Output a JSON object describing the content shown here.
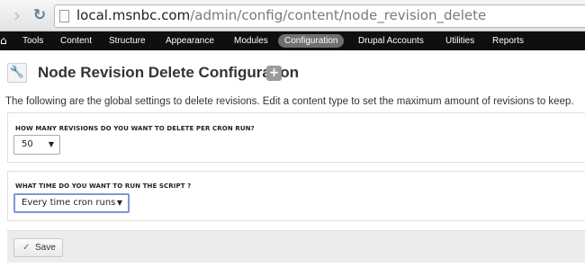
{
  "browser": {
    "url_host": "local.msnbc.com",
    "url_path": "/admin/config/content/node_revision_delete"
  },
  "toolbar": {
    "items": [
      {
        "label": "Tools",
        "active": false
      },
      {
        "label": "Content",
        "active": false
      },
      {
        "label": "Structure",
        "active": false
      },
      {
        "label": "Appearance",
        "active": false
      },
      {
        "label": "Modules",
        "active": false
      },
      {
        "label": "Configuration",
        "active": true
      },
      {
        "label": "Drupal Accounts",
        "active": false
      },
      {
        "label": "Utilities",
        "active": false
      },
      {
        "label": "Reports",
        "active": false
      }
    ]
  },
  "page": {
    "title": "Node Revision Delete Configuration",
    "description": "The following are the global settings to delete revisions. Edit a content type to set the maximum amount of revisions to keep."
  },
  "form": {
    "revisions_per_cron_label": "HOW MANY REVISIONS DO YOU WANT TO DELETE PER CRON RUN?",
    "revisions_per_cron_value": "50",
    "run_time_label": "WHAT TIME DO YOU WANT TO RUN THE SCRIPT ?",
    "run_time_value": "Every time cron runs",
    "save_label": "Save"
  },
  "icons": {
    "back": "back-icon",
    "reload": "reload-icon",
    "home": "home-icon",
    "wrench": "wrench-icon",
    "add": "add-icon",
    "check": "check-icon"
  },
  "colors": {
    "toolbar_background": "#0f0f0f",
    "active_menu": "#6f6f6f",
    "focus_border": "#7a9bd3"
  }
}
